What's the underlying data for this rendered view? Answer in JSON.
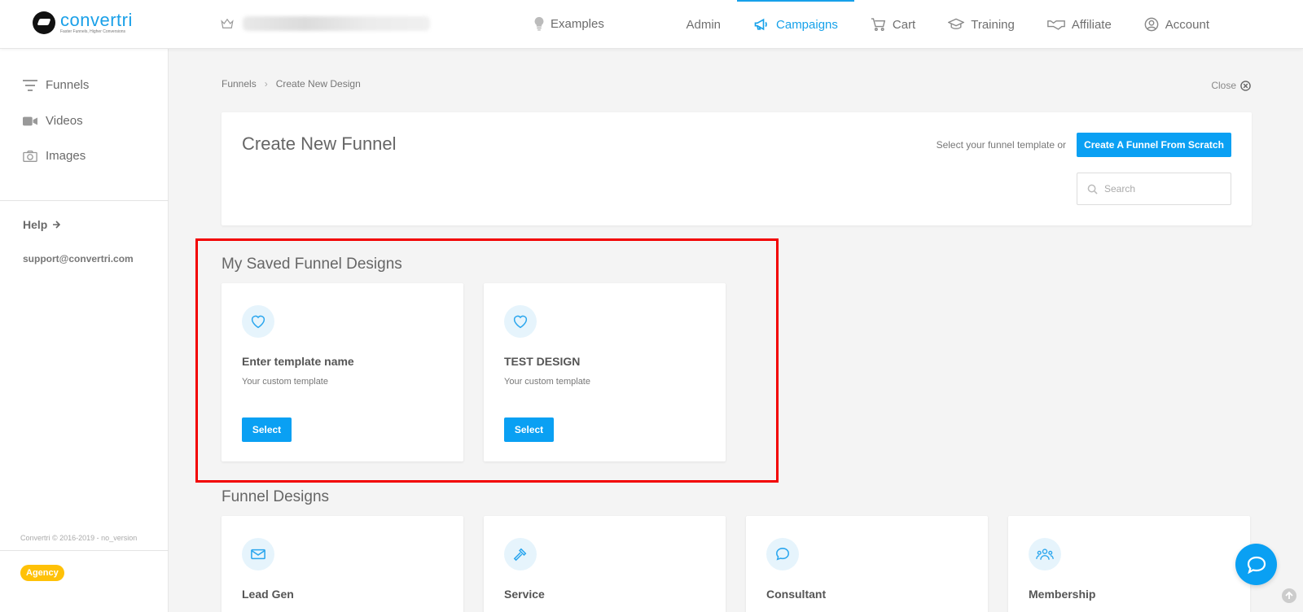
{
  "brand": {
    "name": "convertri",
    "tagline": "Faster Funnels, Higher Conversions"
  },
  "topnav": {
    "examples": "Examples",
    "items": [
      {
        "label": "Admin",
        "icon": "none"
      },
      {
        "label": "Campaigns",
        "icon": "megaphone-icon",
        "active": true
      },
      {
        "label": "Cart",
        "icon": "cart-icon"
      },
      {
        "label": "Training",
        "icon": "graduation-cap-icon"
      },
      {
        "label": "Affiliate",
        "icon": "handshake-icon"
      },
      {
        "label": "Account",
        "icon": "user-circle-icon"
      }
    ]
  },
  "sidebar": {
    "items": [
      {
        "label": "Funnels",
        "icon": "funnel-icon"
      },
      {
        "label": "Videos",
        "icon": "video-icon"
      },
      {
        "label": "Images",
        "icon": "camera-icon"
      }
    ],
    "help": "Help",
    "support_email": "support@convertri.com",
    "copyright": "Convertri © 2016-2019 - no_version",
    "plan_badge": "Agency"
  },
  "breadcrumb": {
    "root": "Funnels",
    "current": "Create New Design"
  },
  "close_label": "Close",
  "header": {
    "title": "Create New Funnel",
    "hint": "Select your funnel template or",
    "scratch_button": "Create A Funnel From Scratch",
    "search_placeholder": "Search"
  },
  "saved_section": {
    "title": "My Saved Funnel Designs",
    "cards": [
      {
        "name": "Enter template name",
        "desc": "Your custom template",
        "button": "Select"
      },
      {
        "name": "TEST DESIGN",
        "desc": "Your custom template",
        "button": "Select"
      }
    ]
  },
  "designs_section": {
    "title": "Funnel Designs",
    "cards": [
      {
        "name": "Lead Gen",
        "icon": "envelope-icon"
      },
      {
        "name": "Service",
        "icon": "hammer-icon"
      },
      {
        "name": "Consultant",
        "icon": "chat-icon"
      },
      {
        "name": "Membership",
        "icon": "users-icon"
      }
    ]
  },
  "colors": {
    "accent": "#0aa0f3",
    "highlight": "#f20000",
    "badge": "#ffc107"
  }
}
